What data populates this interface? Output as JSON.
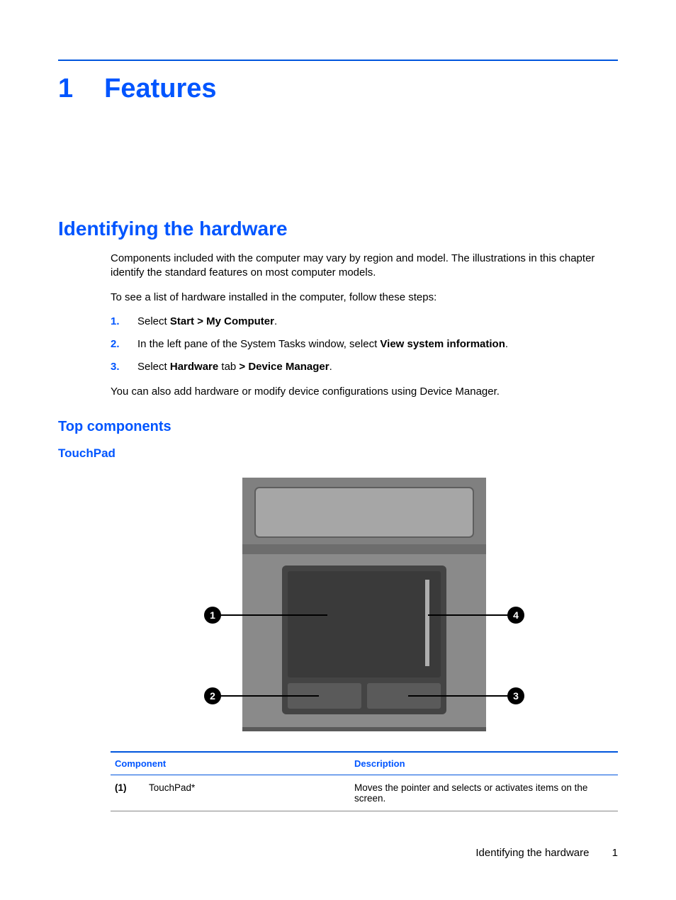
{
  "chapter": {
    "number": "1",
    "title": "Features"
  },
  "section1": "Identifying the hardware",
  "para1": "Components included with the computer may vary by region and model. The illustrations in this chapter identify the standard features on most computer models.",
  "para2": "To see a list of hardware installed in the computer, follow these steps:",
  "steps": [
    {
      "num": "1.",
      "prefix": "Select ",
      "bold": "Start > My Computer",
      "suffix": "."
    },
    {
      "num": "2.",
      "prefix": "In the left pane of the System Tasks window, select ",
      "bold": "View system information",
      "suffix": "."
    },
    {
      "num": "3.",
      "prefix": "Select ",
      "bold": "Hardware",
      "mid": " tab ",
      "bold2": "> Device Manager",
      "suffix": "."
    }
  ],
  "para3": "You can also add hardware or modify device configurations using Device Manager.",
  "section2": "Top components",
  "section3": "TouchPad",
  "callouts": {
    "c1": "1",
    "c2": "2",
    "c3": "3",
    "c4": "4"
  },
  "table": {
    "header_component": "Component",
    "header_description": "Description",
    "rows": [
      {
        "idx": "(1)",
        "name": "TouchPad*",
        "desc": "Moves the pointer and selects or activates items on the screen."
      }
    ]
  },
  "footer": {
    "text": "Identifying the hardware",
    "page": "1"
  }
}
